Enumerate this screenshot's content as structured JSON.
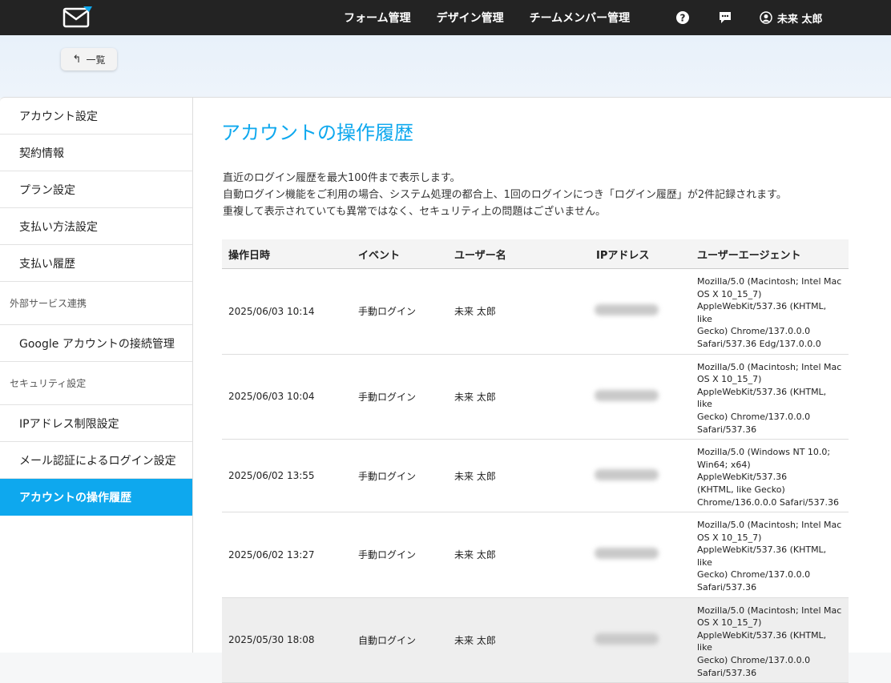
{
  "header": {
    "nav": [
      "フォーム管理",
      "デザイン管理",
      "チームメンバー管理"
    ],
    "user_name": "未来 太郎"
  },
  "back_button": {
    "label": "一覧"
  },
  "sidebar": {
    "items": [
      "アカウント設定",
      "契約情報",
      "プラン設定",
      "支払い方法設定",
      "支払い履歴"
    ],
    "section_external": "外部サービス連携",
    "external_items": [
      "Google アカウントの接続管理"
    ],
    "section_security": "セキュリティ設定",
    "security_items": [
      "IPアドレス制限設定",
      "メール認証によるログイン設定",
      "アカウントの操作履歴"
    ],
    "active": "アカウントの操作履歴"
  },
  "main": {
    "title": "アカウントの操作履歴",
    "desc": [
      "直近のログイン履歴を最大100件まで表示します。",
      "自動ログイン機能をご利用の場合、システム処理の都合上、1回のログインにつき「ログイン履歴」が2件記録されます。",
      "重複して表示されていても異常ではなく、セキュリティ上の問題はございません。"
    ],
    "columns": [
      "操作日時",
      "イベント",
      "ユーザー名",
      "IPアドレス",
      "ユーザーエージェント"
    ],
    "rows": [
      {
        "datetime": "2025/06/03 10:14",
        "event": "手動ログイン",
        "user": "未来 太郎",
        "ua": [
          "Mozilla/5.0 (Macintosh; Intel Mac",
          "OS X 10_15_7)",
          "AppleWebKit/537.36 (KHTML, like",
          "Gecko) Chrome/137.0.0.0",
          "Safari/537.36 Edg/137.0.0.0"
        ]
      },
      {
        "datetime": "2025/06/03 10:04",
        "event": "手動ログイン",
        "user": "未来 太郎",
        "ua": [
          "Mozilla/5.0 (Macintosh; Intel Mac",
          "OS X 10_15_7)",
          "AppleWebKit/537.36 (KHTML, like",
          "Gecko) Chrome/137.0.0.0",
          "Safari/537.36"
        ]
      },
      {
        "datetime": "2025/06/02 13:55",
        "event": "手動ログイン",
        "user": "未来 太郎",
        "ua": [
          "Mozilla/5.0 (Windows NT 10.0;",
          "Win64; x64) AppleWebKit/537.36",
          "(KHTML, like Gecko)",
          "Chrome/136.0.0.0 Safari/537.36"
        ]
      },
      {
        "datetime": "2025/06/02 13:27",
        "event": "手動ログイン",
        "user": "未来 太郎",
        "ua": [
          "Mozilla/5.0 (Macintosh; Intel Mac",
          "OS X 10_15_7)",
          "AppleWebKit/537.36 (KHTML, like",
          "Gecko) Chrome/137.0.0.0",
          "Safari/537.36"
        ]
      },
      {
        "datetime": "2025/05/30 18:08",
        "event": "自動ログイン",
        "user": "未来 太郎",
        "ua": [
          "Mozilla/5.0 (Macintosh; Intel Mac",
          "OS X 10_15_7)",
          "AppleWebKit/537.36 (KHTML, like",
          "Gecko) Chrome/137.0.0.0",
          "Safari/537.36"
        ]
      }
    ]
  },
  "colors": {
    "accent": "#0ea8ee",
    "header_bg": "#232323",
    "banner_bg": "#e8f1fa"
  }
}
